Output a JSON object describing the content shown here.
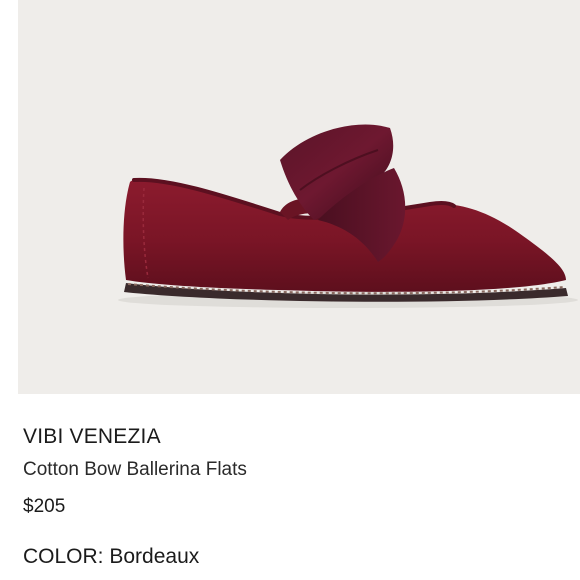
{
  "product": {
    "brand": "VIBI VENEZIA",
    "name": "Cotton Bow Ballerina Flats",
    "price": "$205",
    "color_label": "COLOR:",
    "color_value": "Bordeaux"
  },
  "image": {
    "subject": "burgundy-velvet-bow-ballerina-flat",
    "background_color": "#efedea",
    "shoe_color": "#7a1526"
  }
}
